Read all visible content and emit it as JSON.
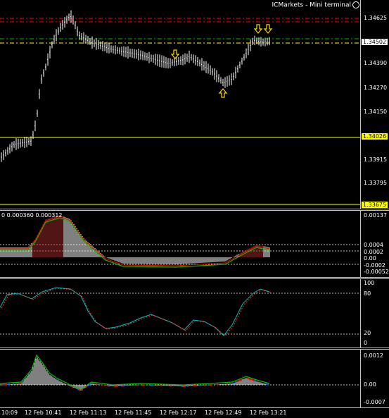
{
  "window": {
    "title": "ICMarkets - Mini terminal"
  },
  "price_axis": {
    "ticks": [
      "1.34625",
      "1.34390",
      "1.34270",
      "1.34150",
      "1.33915",
      "1.33795"
    ],
    "highlight_current": "1.34502",
    "highlight_level": "1.34026",
    "highlight_bottom": "1.33675"
  },
  "macd_pane": {
    "label": "0 0.000360 0.000312",
    "ticks": [
      "0.00137",
      "0.0004",
      "0.0002",
      "0.00",
      "-0.0002",
      "-0.00052"
    ]
  },
  "stoch_pane": {
    "ticks": [
      "100",
      "80",
      "20",
      "0"
    ]
  },
  "osma_pane": {
    "ticks": [
      "0.0012",
      "0.00",
      "-0.0007"
    ]
  },
  "time_axis": {
    "labels": [
      "10:09",
      "12 Feb 10:41",
      "12 Feb 11:13",
      "12 Feb 11:45",
      "12 Feb 12:17",
      "12 Feb 12:49",
      "12 Feb 13:21"
    ]
  },
  "colors": {
    "background": "#000000",
    "bars": "#ffffff",
    "red_line": "#ff0000",
    "green_line": "#00c000",
    "yellow_line": "#ffff00",
    "macd_hist_up": "#ffffff",
    "macd_hist_fill": "#8b0000"
  },
  "markers": [
    "arrow-down-icon",
    "arrow-up-icon"
  ]
}
